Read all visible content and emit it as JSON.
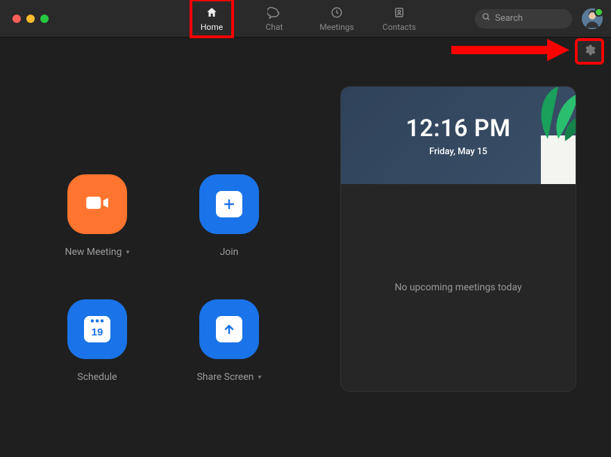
{
  "tabs": {
    "home": "Home",
    "chat": "Chat",
    "meetings": "Meetings",
    "contacts": "Contacts"
  },
  "search": {
    "placeholder": "Search"
  },
  "tiles": {
    "new_meeting": "New Meeting",
    "join": "Join",
    "schedule": "Schedule",
    "share_screen": "Share Screen",
    "calendar_day": "19"
  },
  "clock": {
    "time": "12:16 PM",
    "date": "Friday, May 15"
  },
  "meetings_panel": {
    "empty_text": "No upcoming meetings today"
  }
}
